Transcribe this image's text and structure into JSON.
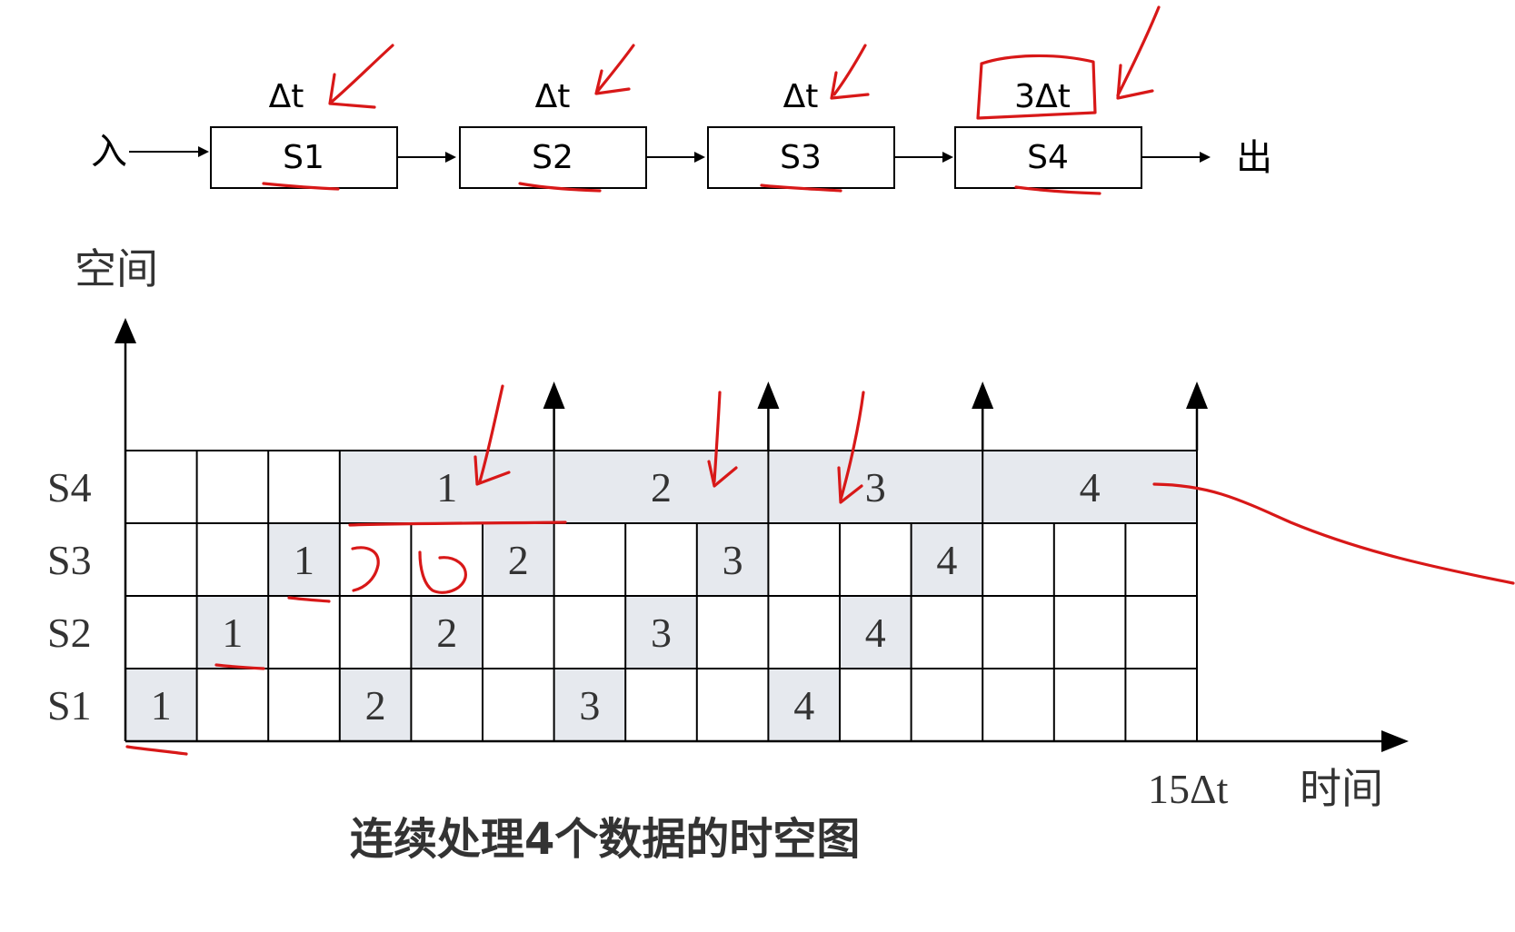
{
  "pipeline": {
    "input_label": "入",
    "output_label": "出",
    "stages": [
      {
        "name": "S1",
        "time": "Δt"
      },
      {
        "name": "S2",
        "time": "Δt"
      },
      {
        "name": "S3",
        "time": "Δt"
      },
      {
        "name": "S4",
        "time": "3Δt"
      }
    ]
  },
  "diagram": {
    "y_axis_label": "空间",
    "x_axis_end_label": "15Δt",
    "x_axis_label": "时间",
    "caption": "连续处理4个数据的时空图",
    "total_slots": 15,
    "rows": [
      "S4",
      "S3",
      "S2",
      "S1"
    ],
    "occupied": [
      {
        "stage": "S1",
        "task": "1",
        "start": 1,
        "span": 1
      },
      {
        "stage": "S1",
        "task": "2",
        "start": 4,
        "span": 1
      },
      {
        "stage": "S1",
        "task": "3",
        "start": 7,
        "span": 1
      },
      {
        "stage": "S1",
        "task": "4",
        "start": 10,
        "span": 1
      },
      {
        "stage": "S2",
        "task": "1",
        "start": 2,
        "span": 1
      },
      {
        "stage": "S2",
        "task": "2",
        "start": 5,
        "span": 1
      },
      {
        "stage": "S2",
        "task": "3",
        "start": 8,
        "span": 1
      },
      {
        "stage": "S2",
        "task": "4",
        "start": 11,
        "span": 1
      },
      {
        "stage": "S3",
        "task": "1",
        "start": 3,
        "span": 1
      },
      {
        "stage": "S3",
        "task": "2",
        "start": 6,
        "span": 1
      },
      {
        "stage": "S3",
        "task": "3",
        "start": 9,
        "span": 1
      },
      {
        "stage": "S3",
        "task": "4",
        "start": 12,
        "span": 1
      },
      {
        "stage": "S4",
        "task": "1",
        "start": 4,
        "span": 3
      },
      {
        "stage": "S4",
        "task": "2",
        "start": 7,
        "span": 3
      },
      {
        "stage": "S4",
        "task": "3",
        "start": 10,
        "span": 3
      },
      {
        "stage": "S4",
        "task": "4",
        "start": 13,
        "span": 3
      }
    ],
    "output_markers": [
      7,
      10,
      13,
      16
    ],
    "cell_fill": "#e6e9ee",
    "annotation_color": "#d81818"
  }
}
